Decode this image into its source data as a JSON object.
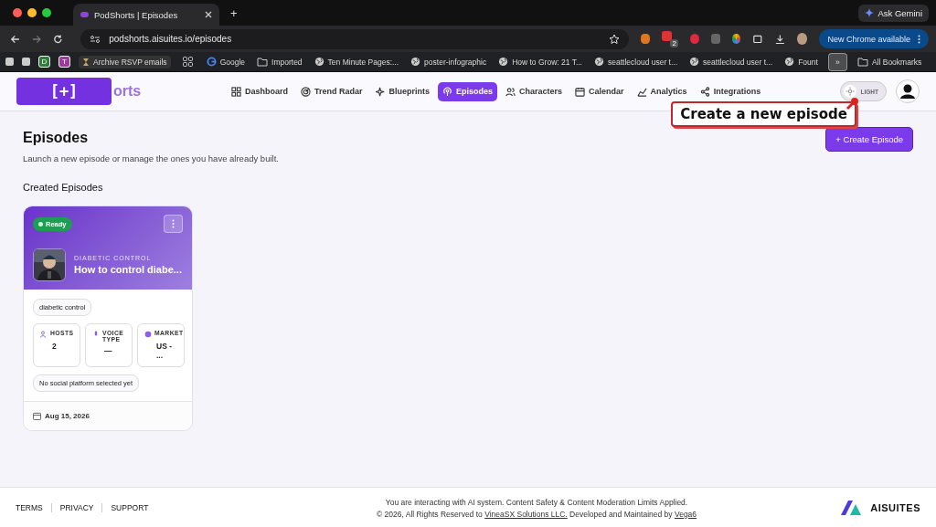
{
  "browser": {
    "tab_title": "PodShorts | Episodes",
    "new_tab": "+",
    "gemini": "Ask Gemini",
    "url": "podshorts.aisuites.io/episodes",
    "extension_badge": "2",
    "update_button": "New Chrome available",
    "bookmarks": [
      {
        "kind": "blank"
      },
      {
        "kind": "blank"
      },
      {
        "kind": "letter",
        "label": "D",
        "color": "#2f7d3a"
      },
      {
        "kind": "letter",
        "label": "T",
        "color": "#9b3b9b"
      },
      {
        "kind": "hourglass",
        "label": "Archive RSVP emails"
      },
      {
        "kind": "apps"
      },
      {
        "kind": "google",
        "label": "Google"
      },
      {
        "kind": "folder",
        "label": "Imported"
      },
      {
        "kind": "globe",
        "label": "Ten Minute Pages:..."
      },
      {
        "kind": "globe",
        "label": "poster-infographic"
      },
      {
        "kind": "globe",
        "label": "How to Grow: 21 T..."
      },
      {
        "kind": "globe",
        "label": "seattlecloud user t..."
      },
      {
        "kind": "globe",
        "label": "seattlecloud user t..."
      },
      {
        "kind": "globe",
        "label": "Fount"
      },
      {
        "kind": "more",
        "label": "»"
      },
      {
        "kind": "folder",
        "label": "All Bookmarks"
      }
    ]
  },
  "app": {
    "logo_overlay": "[+]",
    "logo_visible": "orts",
    "nav": [
      {
        "label": "Dashboard",
        "selected": false
      },
      {
        "label": "Trend Radar",
        "selected": false
      },
      {
        "label": "Blueprints",
        "selected": false
      },
      {
        "label": "Episodes",
        "selected": true
      },
      {
        "label": "Characters",
        "selected": false
      },
      {
        "label": "Calendar",
        "selected": false
      },
      {
        "label": "Analytics",
        "selected": false
      },
      {
        "label": "Integrations",
        "selected": false
      }
    ],
    "theme_toggle": "LIGHT",
    "callout": "Create a new episode",
    "page_title": "Episodes",
    "subtitle": "Launch a new episode or manage the ones you have already built.",
    "create_button": "+ Create Episode",
    "section_title": "Created Episodes",
    "episodes": [
      {
        "status": "Ready",
        "category": "DIABETIC CONTROL",
        "title": "How to control diabe...",
        "tag": "diabetic control",
        "stats": [
          {
            "label": "HOSTS",
            "value": "2"
          },
          {
            "label": "VOICE TYPE",
            "value": "—"
          },
          {
            "label": "MARKET",
            "value": "US - ..."
          }
        ],
        "platforms": "No social platform selected yet",
        "date": "Aug 15, 2026"
      }
    ]
  },
  "footer": {
    "links": [
      "TERMS",
      "PRIVACY",
      "SUPPORT"
    ],
    "notice": "You are interacting with AI system. Content Safety & Content Moderation Limits Applied.",
    "copyright_before": "© 2026, All Rights Reserved to",
    "company_link": "VineaSX Solutions LLC.",
    "copyright_middle": "Developed and Maintained by",
    "developer_link": "Vega6",
    "brand": "AISUITES"
  }
}
